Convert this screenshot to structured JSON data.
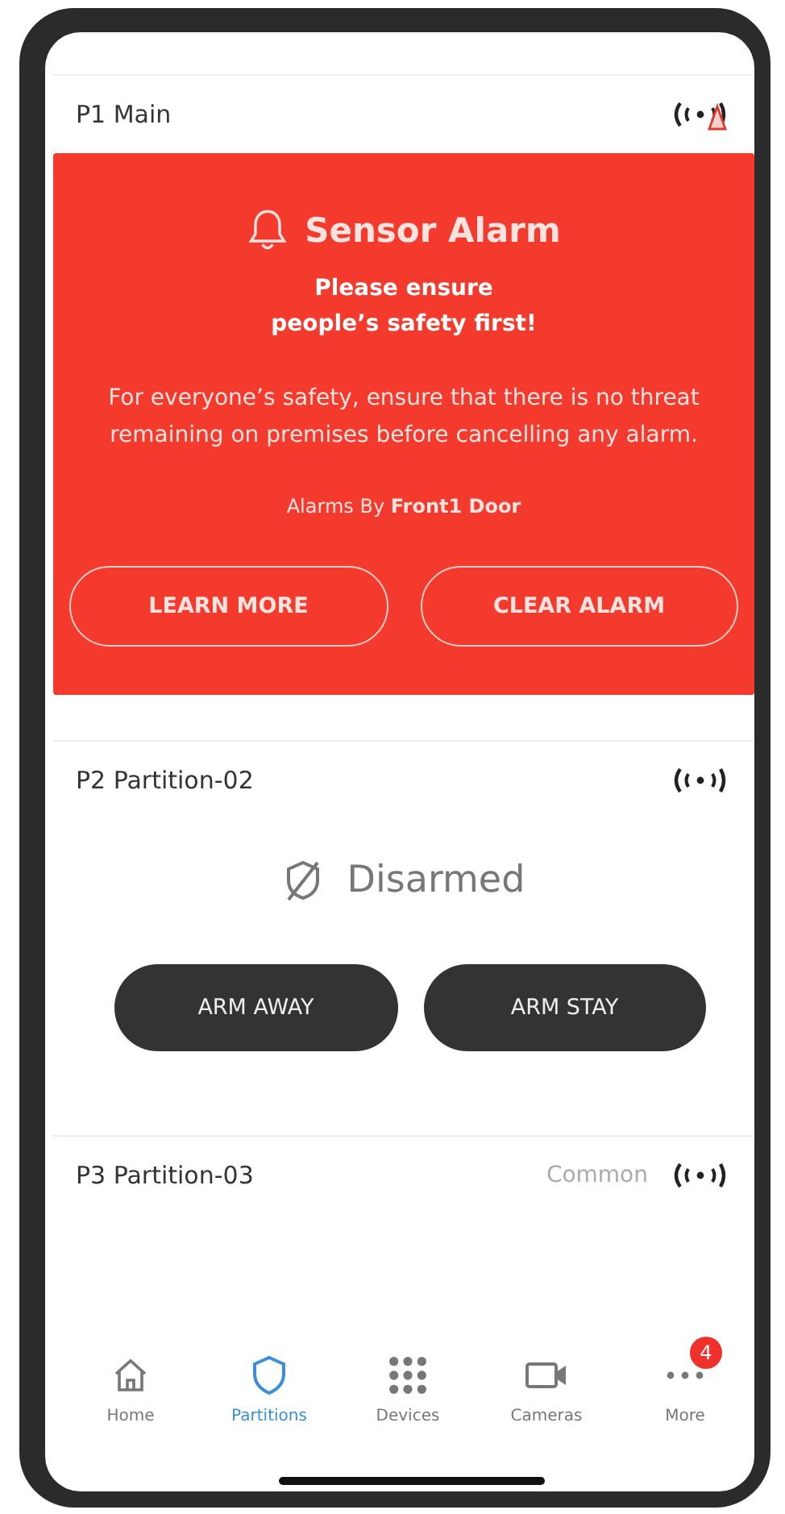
{
  "partitions": [
    {
      "name": "P1 Main",
      "signal_alert": true,
      "alarm": {
        "title": "Sensor Alarm",
        "headline": "Please ensure people’s safety first!",
        "message": "For everyone’s safety, ensure that there is no threat remaining on premises before cancelling any alarm.",
        "source": "Alarms By **Front1 Door**",
        "buttons": [
          "LEARN MORE",
          "CLEAR ALARM"
        ]
      }
    },
    {
      "name": "P2 Partition-02",
      "signal_alert": false,
      "status": "Disarmed",
      "buttons": [
        "ARM AWAY",
        "ARM STAY"
      ]
    },
    {
      "name": "P3 Partition-03",
      "signal_alert": false,
      "tag": "Common"
    }
  ],
  "tabs": [
    {
      "label": "Home",
      "kind": "home",
      "selected": false
    },
    {
      "label": "Partitions",
      "kind": "shield",
      "selected": true
    },
    {
      "label": "Devices",
      "kind": "grid",
      "selected": false
    },
    {
      "label": "Cameras",
      "kind": "camera",
      "selected": false
    },
    {
      "label": "More",
      "kind": "dots",
      "selected": false,
      "badge": "4"
    }
  ]
}
